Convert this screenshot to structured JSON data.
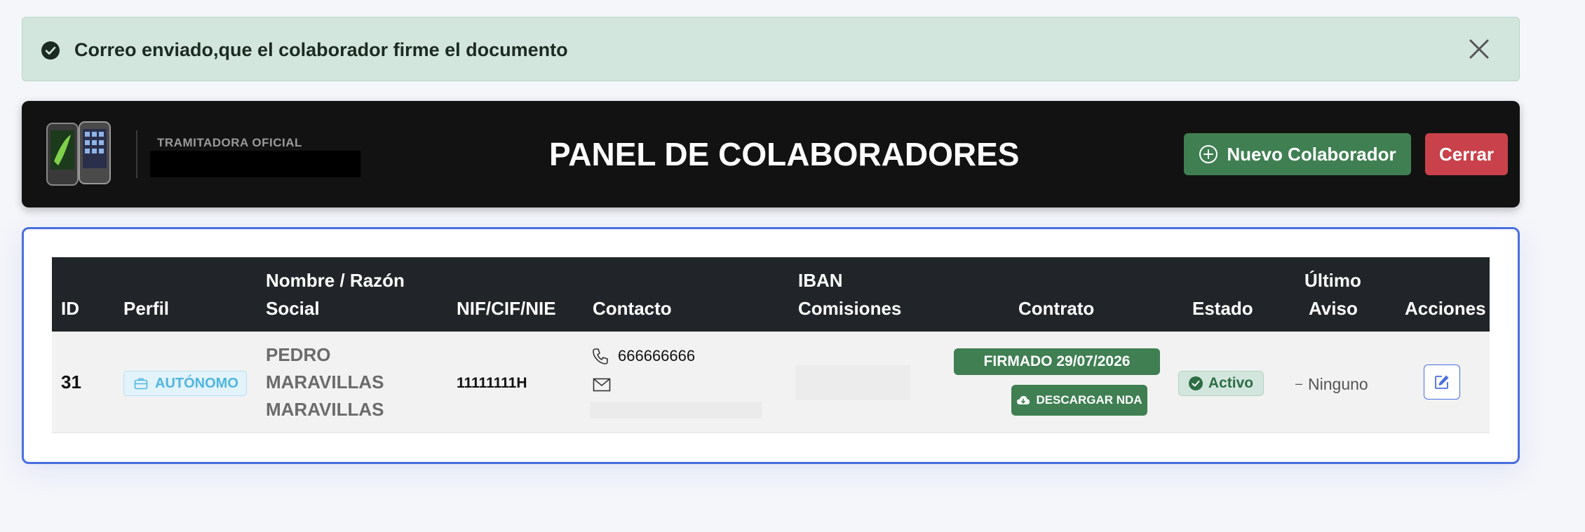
{
  "alert": {
    "message": "Correo enviado,que el colaborador firme el documento",
    "icon": "check-circle-icon",
    "close_icon": "close-icon"
  },
  "header": {
    "brand_label": "TRAMITADORA OFICIAL",
    "title": "PANEL DE COLABORADORES",
    "new_button_label": "Nuevo Colaborador",
    "close_button_label": "Cerrar"
  },
  "table": {
    "columns": {
      "id": "ID",
      "perfil": "Perfil",
      "nombre": [
        "Nombre / Razón",
        "Social"
      ],
      "nif": "NIF/CIF/NIE",
      "contacto": "Contacto",
      "iban": [
        "IBAN",
        "Comisiones"
      ],
      "contrato": "Contrato",
      "estado": "Estado",
      "ultimo": [
        "Último",
        "Aviso"
      ],
      "acciones": "Acciones"
    },
    "rows": [
      {
        "id": "31",
        "perfil": "AUTÓNOMO",
        "nombre": [
          "PEDRO",
          "MARAVILLAS",
          "MARAVILLAS"
        ],
        "nif": "11111111H",
        "phone": "666666666",
        "contrato": "FIRMADO 29/07/2026",
        "nda_button": "DESCARGAR NDA",
        "estado": "Activo",
        "ultimo_aviso": "Ninguno"
      }
    ]
  },
  "colors": {
    "accent_green": "#3f7f52",
    "danger_red": "#c9414a",
    "card_border_blue": "#4a6ee0",
    "header_bg": "#121212",
    "table_head_bg": "#212529"
  }
}
